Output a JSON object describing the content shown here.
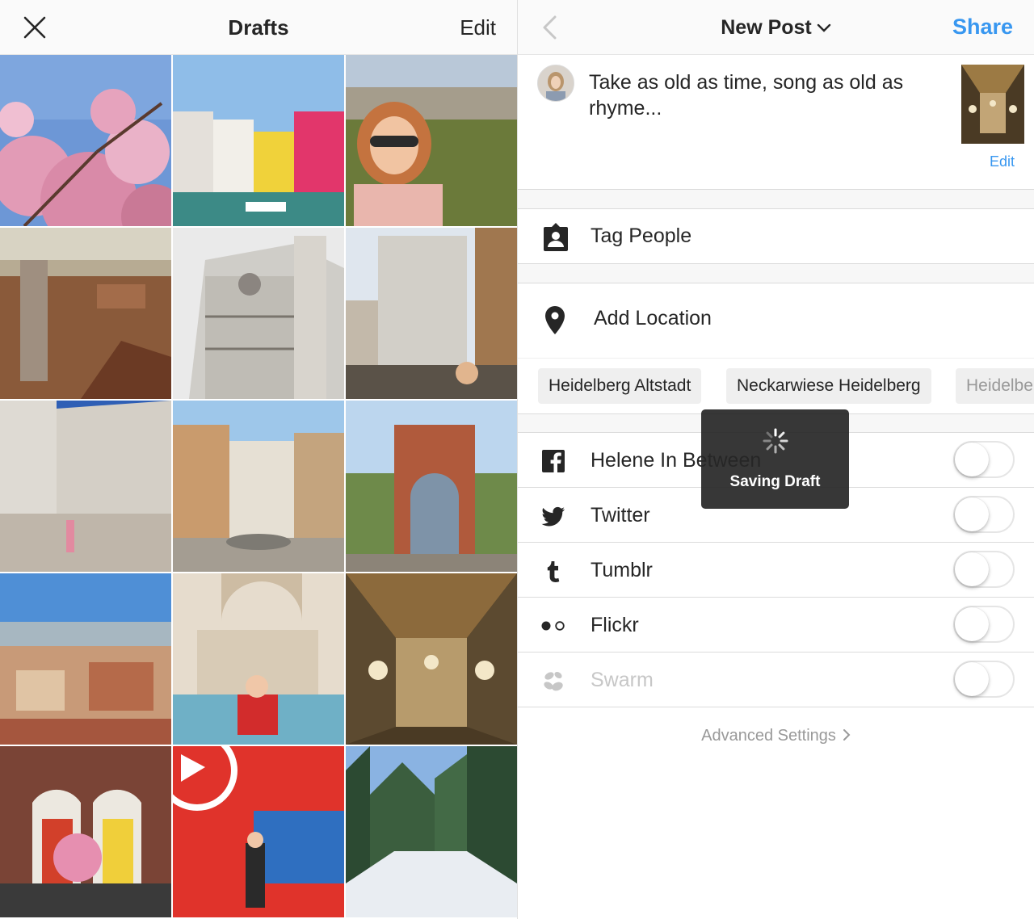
{
  "drafts": {
    "title": "Drafts",
    "edit_label": "Edit",
    "tiles": [
      {
        "subject": "cherry-blossoms",
        "sky": "#6d97d6",
        "ground": "#e3a4bd"
      },
      {
        "subject": "burano-houses",
        "sky": "#8fbde8",
        "ground": "#3c8a86"
      },
      {
        "subject": "florence-selfie",
        "sky": "#b9c8d8",
        "ground": "#6b7a3a"
      },
      {
        "subject": "florence-rooftops",
        "sky": "#d8d3c3",
        "ground": "#8a5a3a"
      },
      {
        "subject": "duomo-facade",
        "sky": "#eaeaea",
        "ground": "#a6a6a0"
      },
      {
        "subject": "duomo-crowd",
        "sky": "#dfe6ee",
        "ground": "#5a5248"
      },
      {
        "subject": "duomo-side",
        "sky": "#2f5fb5",
        "ground": "#bfb6aa"
      },
      {
        "subject": "piazza-fountain",
        "sky": "#9ec7ea",
        "ground": "#a49d92"
      },
      {
        "subject": "garden-gate",
        "sky": "#bcd6ee",
        "ground": "#6e8a4a"
      },
      {
        "subject": "rome-skyline",
        "sky": "#4f8fd6",
        "ground": "#c89a78"
      },
      {
        "subject": "trevi-fountain",
        "sky": "#e6dccd",
        "ground": "#6fb0c6"
      },
      {
        "subject": "versailles-hall",
        "sky": "#4a3a24",
        "ground": "#8c6a3c"
      },
      {
        "subject": "dublin-doors",
        "sky": "#7a4436",
        "ground": "#3a3a3a"
      },
      {
        "subject": "red-wall",
        "sky": "#e0332b",
        "ground": "#2f6fc0"
      },
      {
        "subject": "snowy-forest",
        "sky": "#8ab3e2",
        "ground": "#e9edf2"
      }
    ]
  },
  "post": {
    "title": "New Post",
    "share_label": "Share",
    "caption": "Take as old as time, song as old as rhyme...",
    "thumb_edit_label": "Edit",
    "tag_people": "Tag People",
    "add_location": "Add Location",
    "location_chips": [
      "Heidelberg Altstadt",
      "Neckarwiese Heidelberg",
      "Heidelbe"
    ],
    "share_targets": [
      {
        "label": "Helene In Between",
        "icon": "facebook-icon",
        "enabled": true
      },
      {
        "label": "Twitter",
        "icon": "twitter-icon",
        "enabled": true
      },
      {
        "label": "Tumblr",
        "icon": "tumblr-icon",
        "enabled": true
      },
      {
        "label": "Flickr",
        "icon": "flickr-icon",
        "enabled": true
      },
      {
        "label": "Swarm",
        "icon": "swarm-icon",
        "enabled": false
      }
    ],
    "advanced_settings": "Advanced Settings"
  },
  "toast": {
    "message": "Saving Draft"
  },
  "colors": {
    "accent": "#3897f0",
    "text": "#262626",
    "muted": "#999999"
  }
}
